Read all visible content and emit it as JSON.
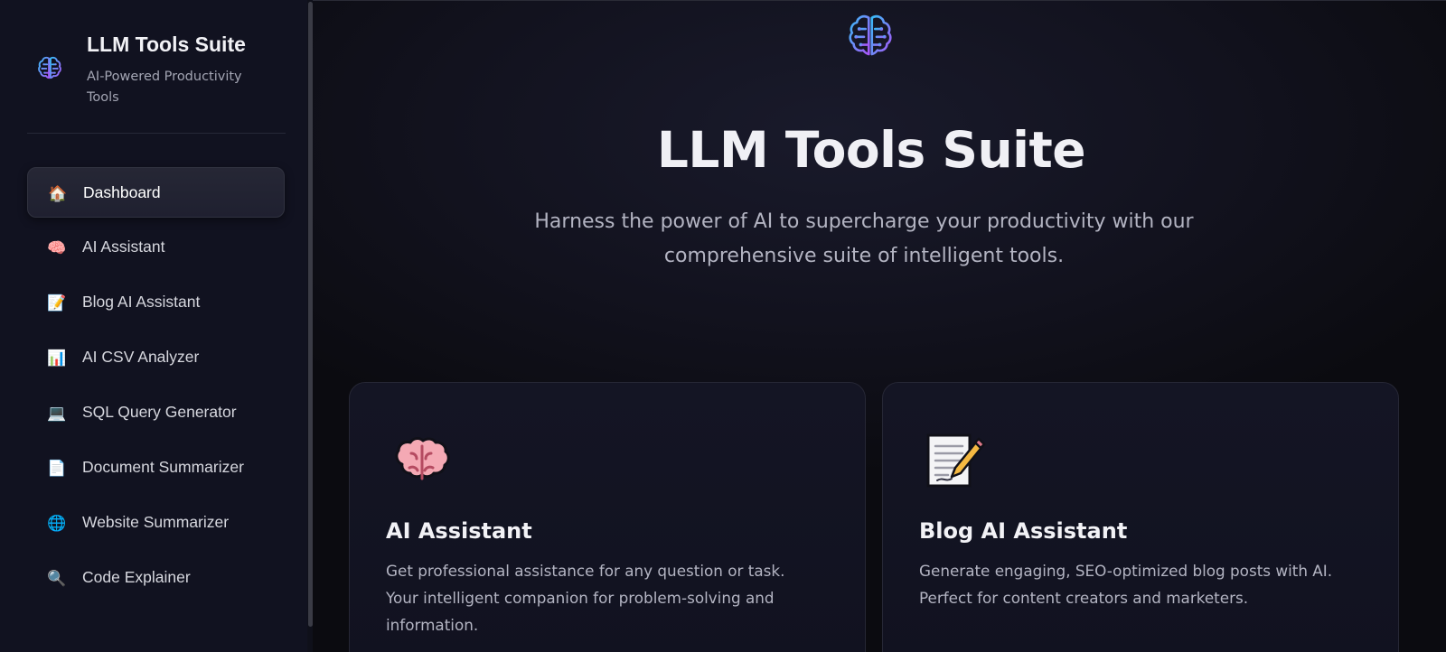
{
  "sidebar": {
    "brand": {
      "logo_icon": "brain-circuit-icon",
      "title": "LLM Tools Suite",
      "subtitle": "AI-Powered Productivity Tools"
    },
    "items": [
      {
        "label": "Dashboard",
        "icon": "🏠",
        "icon_name": "house-icon",
        "active": true
      },
      {
        "label": "AI Assistant",
        "icon": "🧠",
        "icon_name": "brain-icon",
        "active": false
      },
      {
        "label": "Blog AI Assistant",
        "icon": "📝",
        "icon_name": "memo-icon",
        "active": false
      },
      {
        "label": "AI CSV Analyzer",
        "icon": "📊",
        "icon_name": "bar-chart-icon",
        "active": false
      },
      {
        "label": "SQL Query Generator",
        "icon": "💻",
        "icon_name": "laptop-icon",
        "active": false
      },
      {
        "label": "Document Summarizer",
        "icon": "📄",
        "icon_name": "document-icon",
        "active": false
      },
      {
        "label": "Website Summarizer",
        "icon": "🌐",
        "icon_name": "globe-icon",
        "active": false
      },
      {
        "label": "Code Explainer",
        "icon": "🔍",
        "icon_name": "magnifier-icon",
        "active": false
      }
    ]
  },
  "hero": {
    "logo_icon": "brain-circuit-icon",
    "title": "LLM Tools Suite",
    "subtitle": "Harness the power of AI to supercharge your productivity with our comprehensive suite of intelligent tools."
  },
  "cards": [
    {
      "icon_name": "brain-icon",
      "title": "AI Assistant",
      "description": "Get professional assistance for any question or task. Your intelligent companion for problem-solving and information."
    },
    {
      "icon_name": "memo-icon",
      "title": "Blog AI Assistant",
      "description": "Generate engaging, SEO-optimized blog posts with AI. Perfect for content creators and marketers."
    }
  ],
  "colors": {
    "sidebar_bg": "#111220",
    "main_bg": "#0d0d14",
    "accent_gradient_start": "#38bdf8",
    "accent_gradient_end": "#a855f7"
  }
}
